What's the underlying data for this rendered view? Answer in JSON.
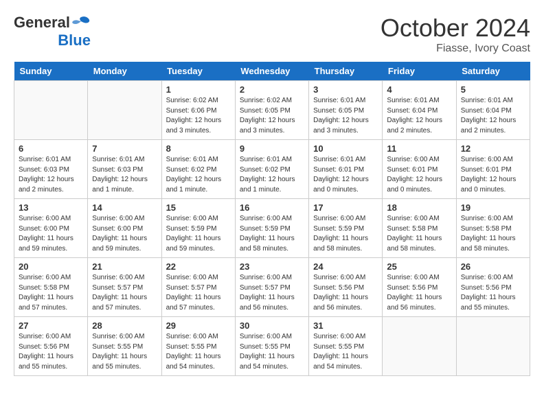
{
  "header": {
    "logo_general": "General",
    "logo_blue": "Blue",
    "month": "October 2024",
    "location": "Fiasse, Ivory Coast"
  },
  "weekdays": [
    "Sunday",
    "Monday",
    "Tuesday",
    "Wednesday",
    "Thursday",
    "Friday",
    "Saturday"
  ],
  "weeks": [
    [
      {
        "day": "",
        "info": ""
      },
      {
        "day": "",
        "info": ""
      },
      {
        "day": "1",
        "info": "Sunrise: 6:02 AM\nSunset: 6:06 PM\nDaylight: 12 hours and 3 minutes."
      },
      {
        "day": "2",
        "info": "Sunrise: 6:02 AM\nSunset: 6:05 PM\nDaylight: 12 hours and 3 minutes."
      },
      {
        "day": "3",
        "info": "Sunrise: 6:01 AM\nSunset: 6:05 PM\nDaylight: 12 hours and 3 minutes."
      },
      {
        "day": "4",
        "info": "Sunrise: 6:01 AM\nSunset: 6:04 PM\nDaylight: 12 hours and 2 minutes."
      },
      {
        "day": "5",
        "info": "Sunrise: 6:01 AM\nSunset: 6:04 PM\nDaylight: 12 hours and 2 minutes."
      }
    ],
    [
      {
        "day": "6",
        "info": "Sunrise: 6:01 AM\nSunset: 6:03 PM\nDaylight: 12 hours and 2 minutes."
      },
      {
        "day": "7",
        "info": "Sunrise: 6:01 AM\nSunset: 6:03 PM\nDaylight: 12 hours and 1 minute."
      },
      {
        "day": "8",
        "info": "Sunrise: 6:01 AM\nSunset: 6:02 PM\nDaylight: 12 hours and 1 minute."
      },
      {
        "day": "9",
        "info": "Sunrise: 6:01 AM\nSunset: 6:02 PM\nDaylight: 12 hours and 1 minute."
      },
      {
        "day": "10",
        "info": "Sunrise: 6:01 AM\nSunset: 6:01 PM\nDaylight: 12 hours and 0 minutes."
      },
      {
        "day": "11",
        "info": "Sunrise: 6:00 AM\nSunset: 6:01 PM\nDaylight: 12 hours and 0 minutes."
      },
      {
        "day": "12",
        "info": "Sunrise: 6:00 AM\nSunset: 6:01 PM\nDaylight: 12 hours and 0 minutes."
      }
    ],
    [
      {
        "day": "13",
        "info": "Sunrise: 6:00 AM\nSunset: 6:00 PM\nDaylight: 11 hours and 59 minutes."
      },
      {
        "day": "14",
        "info": "Sunrise: 6:00 AM\nSunset: 6:00 PM\nDaylight: 11 hours and 59 minutes."
      },
      {
        "day": "15",
        "info": "Sunrise: 6:00 AM\nSunset: 5:59 PM\nDaylight: 11 hours and 59 minutes."
      },
      {
        "day": "16",
        "info": "Sunrise: 6:00 AM\nSunset: 5:59 PM\nDaylight: 11 hours and 58 minutes."
      },
      {
        "day": "17",
        "info": "Sunrise: 6:00 AM\nSunset: 5:59 PM\nDaylight: 11 hours and 58 minutes."
      },
      {
        "day": "18",
        "info": "Sunrise: 6:00 AM\nSunset: 5:58 PM\nDaylight: 11 hours and 58 minutes."
      },
      {
        "day": "19",
        "info": "Sunrise: 6:00 AM\nSunset: 5:58 PM\nDaylight: 11 hours and 58 minutes."
      }
    ],
    [
      {
        "day": "20",
        "info": "Sunrise: 6:00 AM\nSunset: 5:58 PM\nDaylight: 11 hours and 57 minutes."
      },
      {
        "day": "21",
        "info": "Sunrise: 6:00 AM\nSunset: 5:57 PM\nDaylight: 11 hours and 57 minutes."
      },
      {
        "day": "22",
        "info": "Sunrise: 6:00 AM\nSunset: 5:57 PM\nDaylight: 11 hours and 57 minutes."
      },
      {
        "day": "23",
        "info": "Sunrise: 6:00 AM\nSunset: 5:57 PM\nDaylight: 11 hours and 56 minutes."
      },
      {
        "day": "24",
        "info": "Sunrise: 6:00 AM\nSunset: 5:56 PM\nDaylight: 11 hours and 56 minutes."
      },
      {
        "day": "25",
        "info": "Sunrise: 6:00 AM\nSunset: 5:56 PM\nDaylight: 11 hours and 56 minutes."
      },
      {
        "day": "26",
        "info": "Sunrise: 6:00 AM\nSunset: 5:56 PM\nDaylight: 11 hours and 55 minutes."
      }
    ],
    [
      {
        "day": "27",
        "info": "Sunrise: 6:00 AM\nSunset: 5:56 PM\nDaylight: 11 hours and 55 minutes."
      },
      {
        "day": "28",
        "info": "Sunrise: 6:00 AM\nSunset: 5:55 PM\nDaylight: 11 hours and 55 minutes."
      },
      {
        "day": "29",
        "info": "Sunrise: 6:00 AM\nSunset: 5:55 PM\nDaylight: 11 hours and 54 minutes."
      },
      {
        "day": "30",
        "info": "Sunrise: 6:00 AM\nSunset: 5:55 PM\nDaylight: 11 hours and 54 minutes."
      },
      {
        "day": "31",
        "info": "Sunrise: 6:00 AM\nSunset: 5:55 PM\nDaylight: 11 hours and 54 minutes."
      },
      {
        "day": "",
        "info": ""
      },
      {
        "day": "",
        "info": ""
      }
    ]
  ]
}
